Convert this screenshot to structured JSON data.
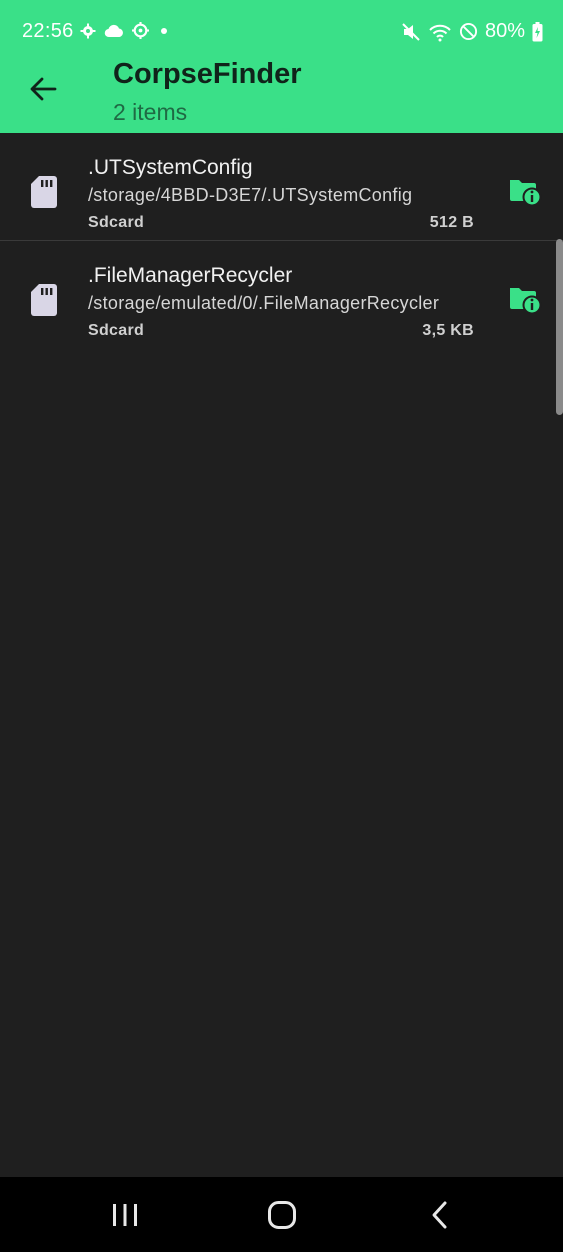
{
  "status_bar": {
    "time": "22:56",
    "battery": "80%",
    "left_icons": [
      "gear-icon",
      "cloud-icon",
      "settings-icon",
      "dot-icon"
    ],
    "right_icons": [
      "mute-icon",
      "wifi-icon",
      "do-not-disturb-icon",
      "battery-charging-icon"
    ]
  },
  "toolbar": {
    "title": "CorpseFinder",
    "subtitle": "2 items",
    "back_icon": "arrow-back-icon"
  },
  "items": [
    {
      "name": ".UTSystemConfig",
      "path": "/storage/4BBD-D3E7/.UTSystemConfig",
      "location": "Sdcard",
      "size": "512 B",
      "icon": "sdcard-icon",
      "action_icon": "folder-info-icon"
    },
    {
      "name": ".FileManagerRecycler",
      "path": "/storage/emulated/0/.FileManagerRecycler",
      "location": "Sdcard",
      "size": "3,5 KB",
      "icon": "sdcard-icon",
      "action_icon": "folder-info-icon"
    }
  ],
  "nav": {
    "recents_icon": "recents-icon",
    "home_icon": "home-icon",
    "back_icon": "nav-back-icon"
  },
  "colors": {
    "accent": "#3ae088",
    "background": "#1f1f1f",
    "nav_background": "#000000"
  }
}
